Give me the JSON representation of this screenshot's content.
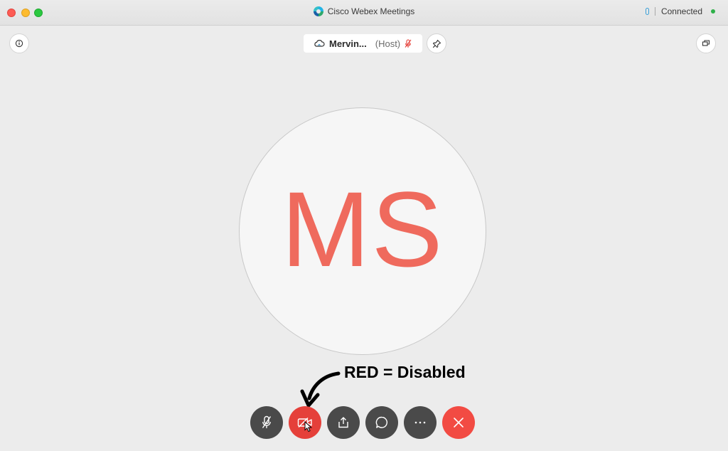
{
  "window": {
    "title": "Cisco Webex Meetings",
    "status": "Connected"
  },
  "host": {
    "name": "Mervin...",
    "role": "(Host)"
  },
  "avatar": {
    "initials": "MS"
  },
  "annotation": {
    "text": "RED = Disabled"
  },
  "controls": {
    "mute": "mic-muted-icon",
    "video": "video-off-icon",
    "share": "share-icon",
    "chat": "chat-icon",
    "more": "more-icon",
    "end": "end-call-icon"
  },
  "colors": {
    "disabled_red": "#e5403a",
    "end_red": "#f24b43",
    "initials": "#ef6a5d",
    "control_dark": "#4a4a4a",
    "connected_green": "#2fb14a"
  }
}
